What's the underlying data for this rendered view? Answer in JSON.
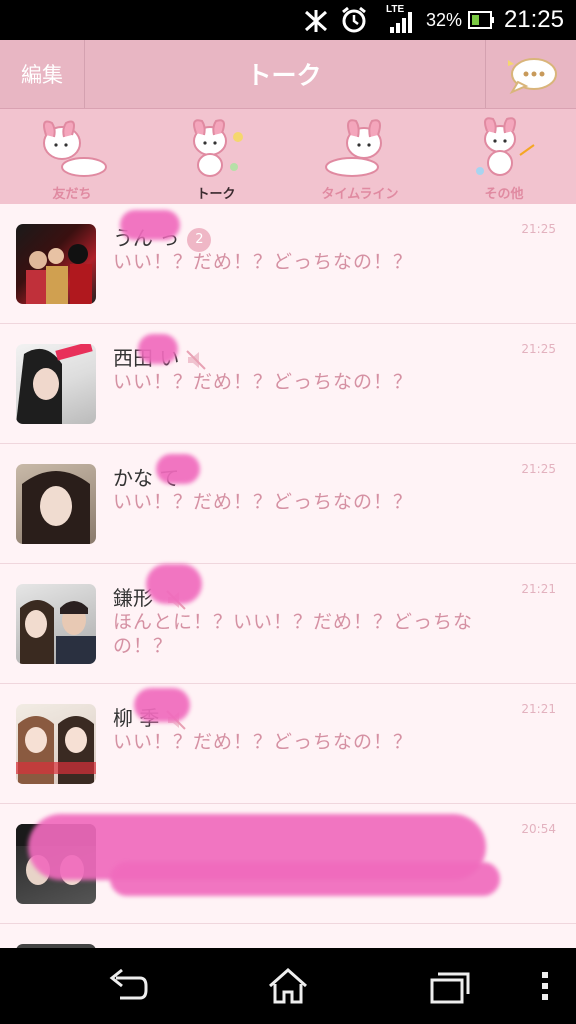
{
  "status_bar": {
    "battery_percent": "32%",
    "time": "21:25",
    "network_label": "LTE",
    "icons": [
      "bluetooth-icon",
      "alarm-icon",
      "signal-icon",
      "battery-icon"
    ]
  },
  "header": {
    "edit_label": "編集",
    "title": "トーク",
    "chat_icon": "new-chat-bubble-icon"
  },
  "tabs": [
    {
      "label": "友だち",
      "active": false
    },
    {
      "label": "トーク",
      "active": true
    },
    {
      "label": "タイムライン",
      "active": false
    },
    {
      "label": "その他",
      "active": false
    }
  ],
  "chats": [
    {
      "name": "うん っ",
      "badge": "2",
      "message": "いい！？だめ！？どっちなの！？",
      "time": "21:25",
      "muted": false
    },
    {
      "name": "西田 い",
      "badge": "",
      "message": "いい！？だめ！？どっちなの！？",
      "time": "21:25",
      "muted": true
    },
    {
      "name": "かな て",
      "badge": "",
      "message": "いい！？だめ！？どっちなの！？",
      "time": "21:25",
      "muted": false
    },
    {
      "name": "鎌形 ",
      "badge": "",
      "message": "ほんとに！？いい！？だめ！？どっちなの！？",
      "time": "21:21",
      "muted": true
    },
    {
      "name": "柳 季",
      "badge": "",
      "message": "いい！？だめ！？どっちなの！？",
      "time": "21:21",
      "muted": true
    },
    {
      "name": "",
      "badge": "",
      "message": "",
      "time": "20:54",
      "muted": false
    }
  ],
  "colors": {
    "header": "#e8b6c3",
    "tabs": "#f2c3cf",
    "list_bg": "#fff3f6",
    "message_text": "#d591a3",
    "redaction": "#f06bbd"
  }
}
